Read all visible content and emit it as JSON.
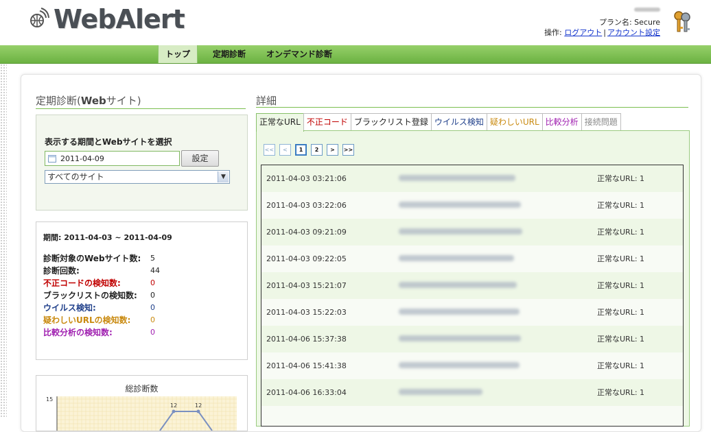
{
  "header": {
    "logo_text": "WebAlert",
    "plan_label": "プラン名: Secure",
    "ops_label": "操作:",
    "logout": "ログアウト",
    "separator": "|",
    "account_settings": "アカウント設定"
  },
  "nav": {
    "items": [
      {
        "label": "トップ",
        "active": true
      },
      {
        "label": "定期診断",
        "active": false
      },
      {
        "label": "オンデマンド診断",
        "active": false
      }
    ]
  },
  "left": {
    "title_prefix": "定期診断(",
    "title_bold": "Web",
    "title_suffix": "サイト)",
    "select_box": {
      "title": "表示する期間とWebサイトを選択",
      "date_value": "2011-04-09",
      "set_button": "設定",
      "site_select": "すべてのサイト"
    },
    "stats": {
      "period": "期間: 2011-04-03 ~ 2011-04-09",
      "rows": [
        {
          "label": "診断対象のWebサイト数:",
          "value": "5",
          "color": "#222222"
        },
        {
          "label": "診断回数:",
          "value": "44",
          "color": "#222222"
        },
        {
          "label": "不正コードの検知数:",
          "value": "0",
          "color": "#c00000"
        },
        {
          "label": "ブラックリストの検知数:",
          "value": "0",
          "color": "#222222"
        },
        {
          "label": "ウイルス検知:",
          "value": "0",
          "color": "#1f3f8a"
        },
        {
          "label": "疑わしいURLの検知数:",
          "value": "0",
          "color": "#c98a10"
        },
        {
          "label": "比較分析の検知数:",
          "value": "0",
          "color": "#a020b0"
        }
      ]
    },
    "chart_title": "総診断数"
  },
  "chart_data": {
    "type": "line",
    "title": "総診断数",
    "xlabel": "",
    "ylabel": "",
    "y_tick_labels": [
      "15"
    ],
    "data_labels": [
      "12",
      "12"
    ]
  },
  "right": {
    "title": "詳細",
    "tabs": [
      {
        "label": "正常なURL",
        "color": "#222222",
        "active": true
      },
      {
        "label": "不正コード",
        "color": "#c00000",
        "active": false
      },
      {
        "label": "ブラックリスト登録",
        "color": "#222222",
        "active": false
      },
      {
        "label": "ウイルス検知",
        "color": "#1f3f8a",
        "active": false
      },
      {
        "label": "疑わしいURL",
        "color": "#c98a10",
        "active": false
      },
      {
        "label": "比較分析",
        "color": "#a020b0",
        "active": false
      },
      {
        "label": "接続問題",
        "color": "#888888",
        "active": false
      }
    ],
    "pager": {
      "first": "<<",
      "prev": "<",
      "pages": [
        "1",
        "2"
      ],
      "next": ">",
      "last": ">>"
    },
    "rows": [
      {
        "timestamp": "2011-04-03 03:21:06",
        "status": "正常なURL: 1"
      },
      {
        "timestamp": "2011-04-03 03:22:06",
        "status": "正常なURL: 1"
      },
      {
        "timestamp": "2011-04-03 09:21:09",
        "status": "正常なURL: 1"
      },
      {
        "timestamp": "2011-04-03 09:22:05",
        "status": "正常なURL: 1"
      },
      {
        "timestamp": "2011-04-03 15:21:07",
        "status": "正常なURL: 1"
      },
      {
        "timestamp": "2011-04-03 15:22:03",
        "status": "正常なURL: 1"
      },
      {
        "timestamp": "2011-04-06 15:37:38",
        "status": "正常なURL: 1"
      },
      {
        "timestamp": "2011-04-06 15:41:38",
        "status": "正常なURL: 1"
      },
      {
        "timestamp": "2011-04-06 16:33:04",
        "status": "正常なURL: 1"
      },
      {
        "timestamp": "",
        "status": ""
      }
    ]
  }
}
